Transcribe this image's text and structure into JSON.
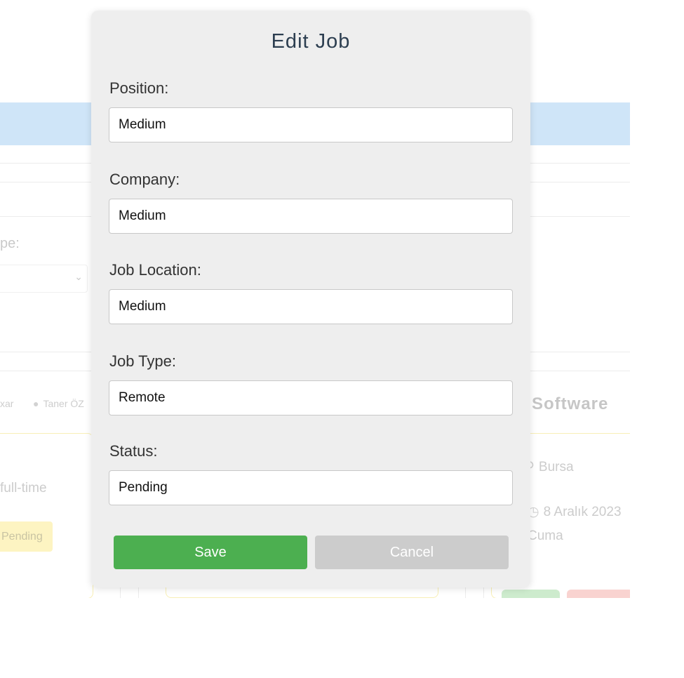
{
  "modal": {
    "title": "Edit Job",
    "fields": {
      "position": {
        "label": "Position:",
        "value": "Medium"
      },
      "company": {
        "label": "Company:",
        "value": "Medium"
      },
      "job_location": {
        "label": "Job Location:",
        "value": "Medium"
      },
      "job_type": {
        "label": "Job Type:",
        "value": "Remote"
      },
      "status": {
        "label": "Status:",
        "value": "Pending"
      }
    },
    "save_label": "Save",
    "cancel_label": "Cancel"
  },
  "background": {
    "filter_label_fragment": "pe:",
    "card_left": {
      "company_fragment": "xar",
      "author": "Taner ÖZ",
      "job_type_fragment": "full-time",
      "status_badge": "Pending"
    },
    "card_right": {
      "title_fragment": "Software",
      "location": "Bursa",
      "date": "8 Aralık 2023",
      "day_fragment": "Cuma"
    }
  },
  "colors": {
    "save": "#4caf50",
    "cancel": "#cccccc",
    "modal_bg": "#eeeeee",
    "title": "#2c3e50",
    "backdrop_bar": "#cfe5f8",
    "badge": "#fdf4c2"
  }
}
